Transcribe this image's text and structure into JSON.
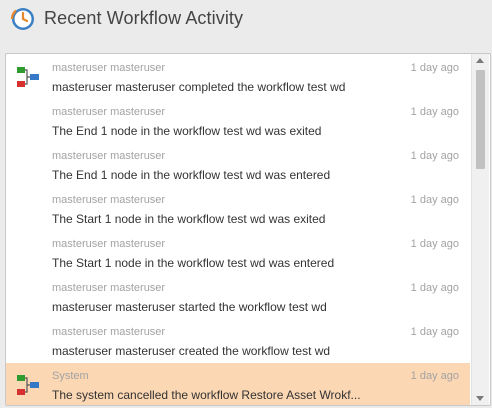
{
  "header": {
    "title": "Recent Workflow Activity",
    "logo_icon": "clock-workflow-icon"
  },
  "colors": {
    "highlight": "#fbd7b3",
    "muted": "#a3a3a3",
    "text": "#333333"
  },
  "activity": [
    {
      "user": "masteruser masteruser",
      "time": "1 day ago",
      "message": "masteruser masteruser completed the workflow test wd",
      "icon": "workflow-icon",
      "highlighted": false
    },
    {
      "user": "masteruser masteruser",
      "time": "1 day ago",
      "message": "The End 1 node in the workflow test wd was exited",
      "icon": "",
      "highlighted": false
    },
    {
      "user": "masteruser masteruser",
      "time": "1 day ago",
      "message": "The End 1 node in the workflow test wd was entered",
      "icon": "",
      "highlighted": false
    },
    {
      "user": "masteruser masteruser",
      "time": "1 day ago",
      "message": "The Start 1 node in the workflow test wd was exited",
      "icon": "",
      "highlighted": false
    },
    {
      "user": "masteruser masteruser",
      "time": "1 day ago",
      "message": "The Start 1 node in the workflow test wd was entered",
      "icon": "",
      "highlighted": false
    },
    {
      "user": "masteruser masteruser",
      "time": "1 day ago",
      "message": "masteruser masteruser started the workflow test wd",
      "icon": "",
      "highlighted": false
    },
    {
      "user": "masteruser masteruser",
      "time": "1 day ago",
      "message": "masteruser masteruser created the workflow test wd",
      "icon": "",
      "highlighted": false
    },
    {
      "user": "System",
      "time": "1 day ago",
      "message": "The system cancelled the workflow Restore Asset Wrokf...",
      "icon": "workflow-icon",
      "highlighted": true
    }
  ]
}
